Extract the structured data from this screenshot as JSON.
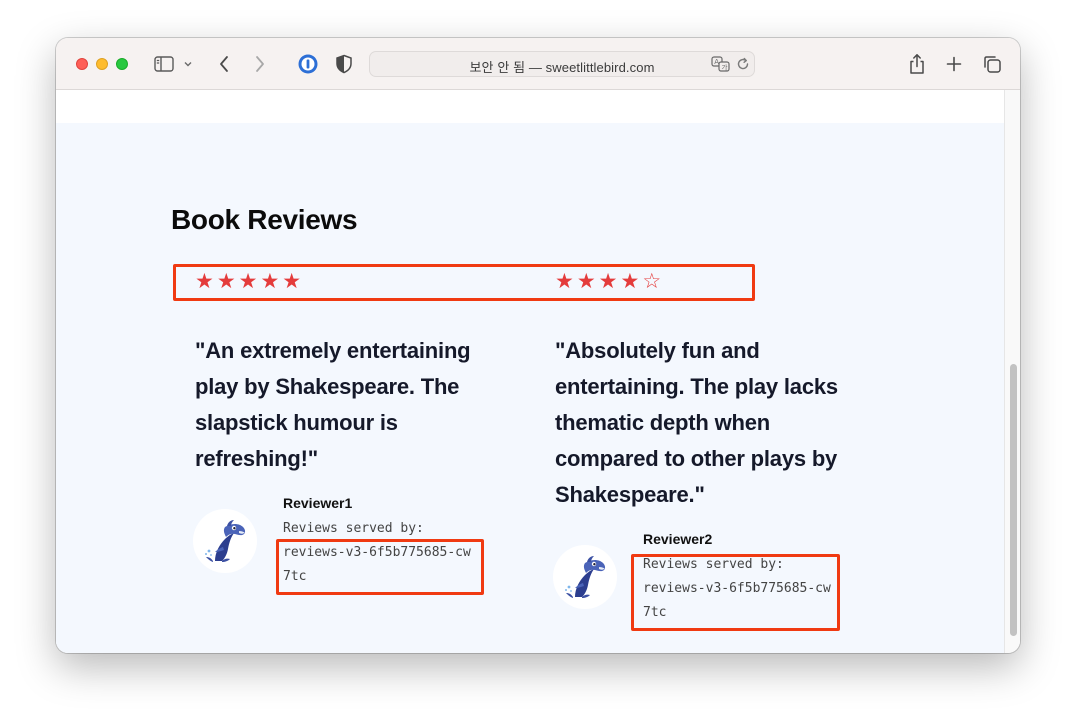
{
  "browser": {
    "url_text": "보안 안 됨 — sweetlittlebird.com"
  },
  "page": {
    "title": "Book Reviews"
  },
  "reviews": [
    {
      "rating": 5,
      "max_rating": 5,
      "stars_filled": "★★★★★",
      "stars_empty": "",
      "text": "\"An extremely entertaining play by Shakespeare. The slapstick humour is refreshing!\"",
      "reviewer": "Reviewer1",
      "served_by_label": "Reviews served by:",
      "served_by_pod": "reviews-v3-6f5b775685-cw7tc"
    },
    {
      "rating": 4,
      "max_rating": 5,
      "stars_filled": "★★★★",
      "stars_empty": "☆",
      "text": "\"Absolutely fun and entertaining. The play lacks thematic depth when compared to other plays by Shakespeare.\"",
      "reviewer": "Reviewer2",
      "served_by_label": "Reviews served by:",
      "served_by_pod": "reviews-v3-6f5b775685-cw7tc"
    }
  ],
  "colors": {
    "star": "#e43c3c",
    "highlight": "#f03a12",
    "section_bg": "#f4f8fe"
  },
  "icons": {
    "sidebar": "sidebar-icon",
    "back": "chevron-left-icon",
    "forward": "chevron-right-icon",
    "password": "password-manager-icon",
    "privacy": "shield-icon",
    "translate": "translate-icon",
    "reload": "reload-icon",
    "share": "share-icon",
    "new_tab": "plus-icon",
    "tabs": "tab-overview-icon",
    "avatar": "dolphin-icon"
  }
}
